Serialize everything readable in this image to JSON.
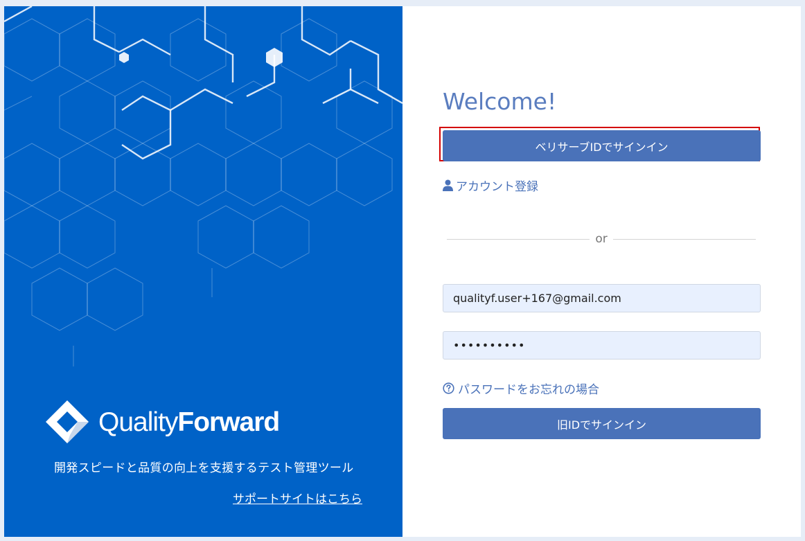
{
  "brand": {
    "name_light": "Quality",
    "name_bold": "Forward",
    "tagline": "開発スピードと品質の向上を支援するテスト管理ツール",
    "support_link": "サポートサイトはこちら",
    "logo_icon": "diamond-logo-icon"
  },
  "login": {
    "welcome": "Welcome!",
    "verisurf_button": "ベリサーブIDでサインイン",
    "account_register": "アカウント登録",
    "divider_text": "or",
    "email_value": "qualityf.user+167@gmail.com",
    "password_value": "••••••••••",
    "forgot_password": "パスワードをお忘れの場合",
    "legacy_button": "旧IDでサインイン"
  },
  "icons": {
    "account": "user-icon",
    "forgot": "question-circle-icon"
  },
  "colors": {
    "brand_blue": "#0062c7",
    "button_blue": "#4a72b9",
    "highlight_red": "#d40000",
    "input_bg": "#e8f0fe"
  }
}
